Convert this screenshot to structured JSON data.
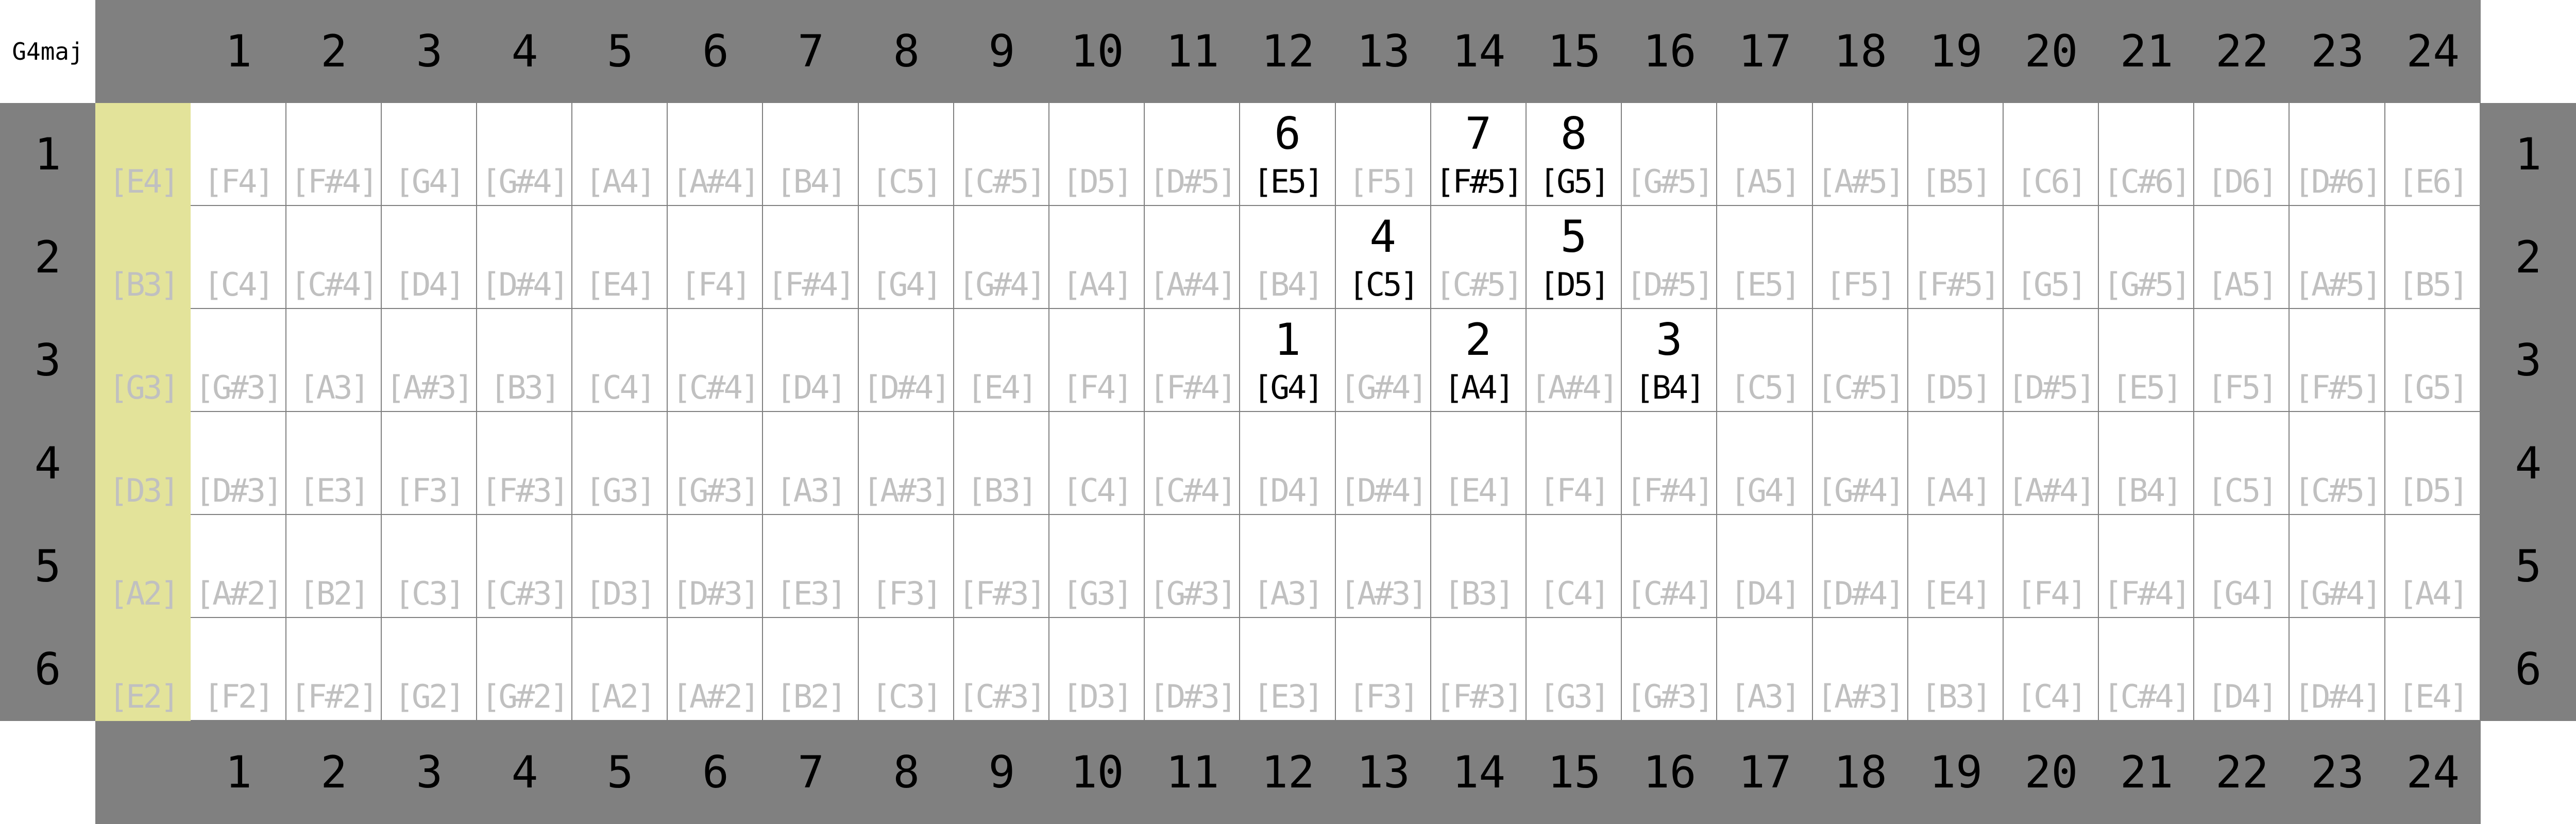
{
  "title": "G4maj",
  "colors": {
    "header": "#808080",
    "open_string": "#e3e39a",
    "inactive_note": "#c0c0c0",
    "active_note": "#000000",
    "grid_line": "#808080"
  },
  "frets": [
    "1",
    "2",
    "3",
    "4",
    "5",
    "6",
    "7",
    "8",
    "9",
    "10",
    "11",
    "12",
    "13",
    "14",
    "15",
    "16",
    "17",
    "18",
    "19",
    "20",
    "21",
    "22",
    "23",
    "24"
  ],
  "strings": [
    {
      "label": "1",
      "notes": [
        "[E4]",
        "[F4]",
        "[F#4]",
        "[G4]",
        "[G#4]",
        "[A4]",
        "[A#4]",
        "[B4]",
        "[C5]",
        "[C#5]",
        "[D5]",
        "[D#5]",
        "[E5]",
        "[F5]",
        "[F#5]",
        "[G5]",
        "[G#5]",
        "[A5]",
        "[A#5]",
        "[B5]",
        "[C6]",
        "[C#6]",
        "[D6]",
        "[D#6]",
        "[E6]"
      ],
      "marks": {
        "12": "6",
        "14": "7",
        "15": "8"
      }
    },
    {
      "label": "2",
      "notes": [
        "[B3]",
        "[C4]",
        "[C#4]",
        "[D4]",
        "[D#4]",
        "[E4]",
        "[F4]",
        "[F#4]",
        "[G4]",
        "[G#4]",
        "[A4]",
        "[A#4]",
        "[B4]",
        "[C5]",
        "[C#5]",
        "[D5]",
        "[D#5]",
        "[E5]",
        "[F5]",
        "[F#5]",
        "[G5]",
        "[G#5]",
        "[A5]",
        "[A#5]",
        "[B5]"
      ],
      "marks": {
        "13": "4",
        "15": "5"
      }
    },
    {
      "label": "3",
      "notes": [
        "[G3]",
        "[G#3]",
        "[A3]",
        "[A#3]",
        "[B3]",
        "[C4]",
        "[C#4]",
        "[D4]",
        "[D#4]",
        "[E4]",
        "[F4]",
        "[F#4]",
        "[G4]",
        "[G#4]",
        "[A4]",
        "[A#4]",
        "[B4]",
        "[C5]",
        "[C#5]",
        "[D5]",
        "[D#5]",
        "[E5]",
        "[F5]",
        "[F#5]",
        "[G5]"
      ],
      "marks": {
        "12": "1",
        "14": "2",
        "16": "3"
      }
    },
    {
      "label": "4",
      "notes": [
        "[D3]",
        "[D#3]",
        "[E3]",
        "[F3]",
        "[F#3]",
        "[G3]",
        "[G#3]",
        "[A3]",
        "[A#3]",
        "[B3]",
        "[C4]",
        "[C#4]",
        "[D4]",
        "[D#4]",
        "[E4]",
        "[F4]",
        "[F#4]",
        "[G4]",
        "[G#4]",
        "[A4]",
        "[A#4]",
        "[B4]",
        "[C5]",
        "[C#5]",
        "[D5]"
      ],
      "marks": {}
    },
    {
      "label": "5",
      "notes": [
        "[A2]",
        "[A#2]",
        "[B2]",
        "[C3]",
        "[C#3]",
        "[D3]",
        "[D#3]",
        "[E3]",
        "[F3]",
        "[F#3]",
        "[G3]",
        "[G#3]",
        "[A3]",
        "[A#3]",
        "[B3]",
        "[C4]",
        "[C#4]",
        "[D4]",
        "[D#4]",
        "[E4]",
        "[F4]",
        "[F#4]",
        "[G4]",
        "[G#4]",
        "[A4]"
      ],
      "marks": {}
    },
    {
      "label": "6",
      "notes": [
        "[E2]",
        "[F2]",
        "[F#2]",
        "[G2]",
        "[G#2]",
        "[A2]",
        "[A#2]",
        "[B2]",
        "[C3]",
        "[C#3]",
        "[D3]",
        "[D#3]",
        "[E3]",
        "[F3]",
        "[F#3]",
        "[G3]",
        "[G#3]",
        "[A3]",
        "[A#3]",
        "[B3]",
        "[C4]",
        "[C#4]",
        "[D4]",
        "[D#4]",
        "[E4]"
      ],
      "marks": {}
    }
  ]
}
